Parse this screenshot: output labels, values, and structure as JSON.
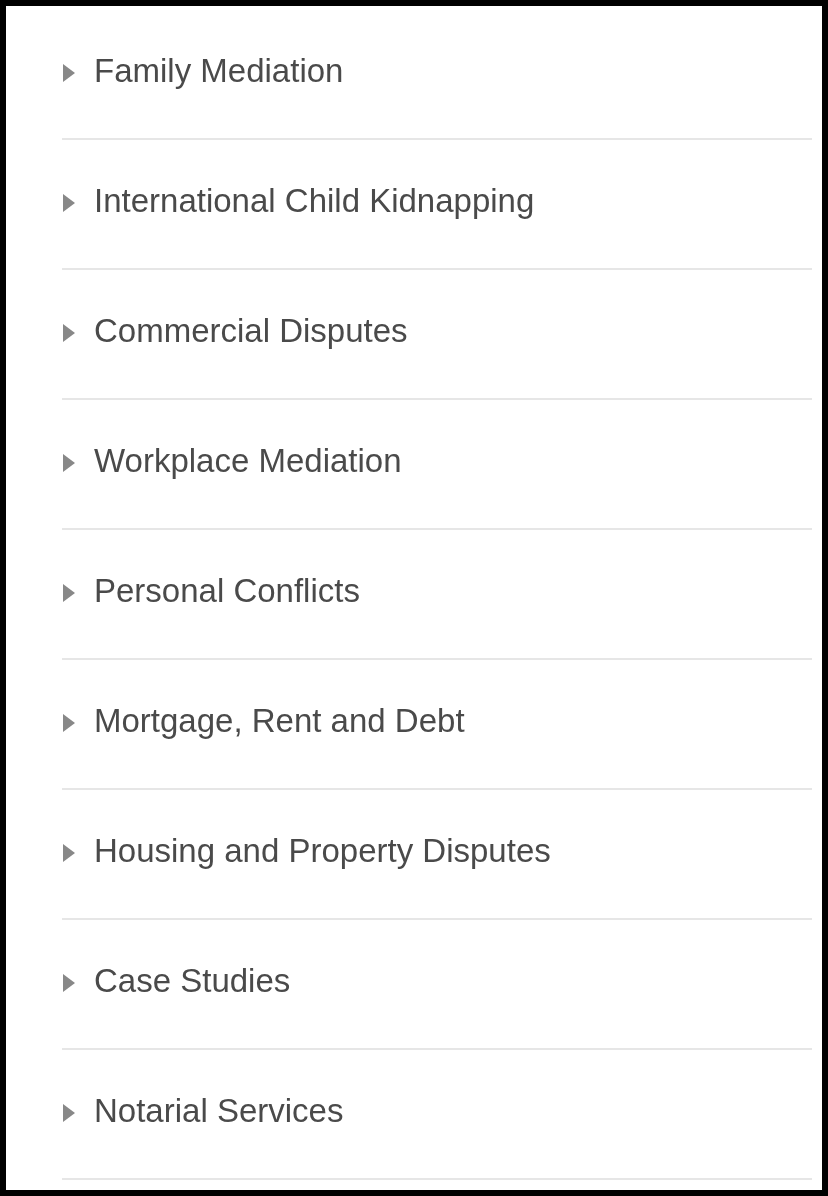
{
  "menu": [
    {
      "label": "Family Mediation",
      "expanded": false
    },
    {
      "label": "International Child Kidnapping",
      "expanded": false
    },
    {
      "label": "Commercial Disputes",
      "expanded": false
    },
    {
      "label": "Workplace Mediation",
      "expanded": false
    },
    {
      "label": "Personal Conflicts",
      "expanded": false
    },
    {
      "label": "Mortgage, Rent and Debt",
      "expanded": false
    },
    {
      "label": "Housing and Property Disputes",
      "expanded": false
    },
    {
      "label": "Case Studies",
      "expanded": false
    },
    {
      "label": "Notarial Services",
      "expanded": false
    }
  ]
}
